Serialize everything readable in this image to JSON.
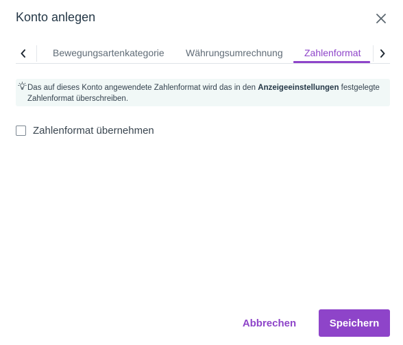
{
  "dialog": {
    "title": "Konto anlegen",
    "close_icon": "close-icon"
  },
  "tabs": {
    "items": [
      {
        "label": "Bewegungsartenkategorie",
        "active": false
      },
      {
        "label": "Währungsumrechnung",
        "active": false
      },
      {
        "label": "Zahlenformat",
        "active": true
      }
    ],
    "scroll_left_icon": "chevron-left-icon",
    "scroll_right_icon": "chevron-right-icon"
  },
  "info": {
    "icon": "lightbulb-icon",
    "text_before": "Das auf dieses Konto angewendete Zahlenformat wird das in den ",
    "link_text": "Anzeigeeinstellungen",
    "text_after": " festgelegte Zahlenformat überschreiben."
  },
  "option": {
    "label": "Zahlenformat übernehmen",
    "checked": false
  },
  "footer": {
    "cancel_label": "Abbrechen",
    "save_label": "Speichern"
  },
  "colors": {
    "accent": "#8e44c9",
    "info_background": "#f1f8f7",
    "title_text": "#243746"
  }
}
